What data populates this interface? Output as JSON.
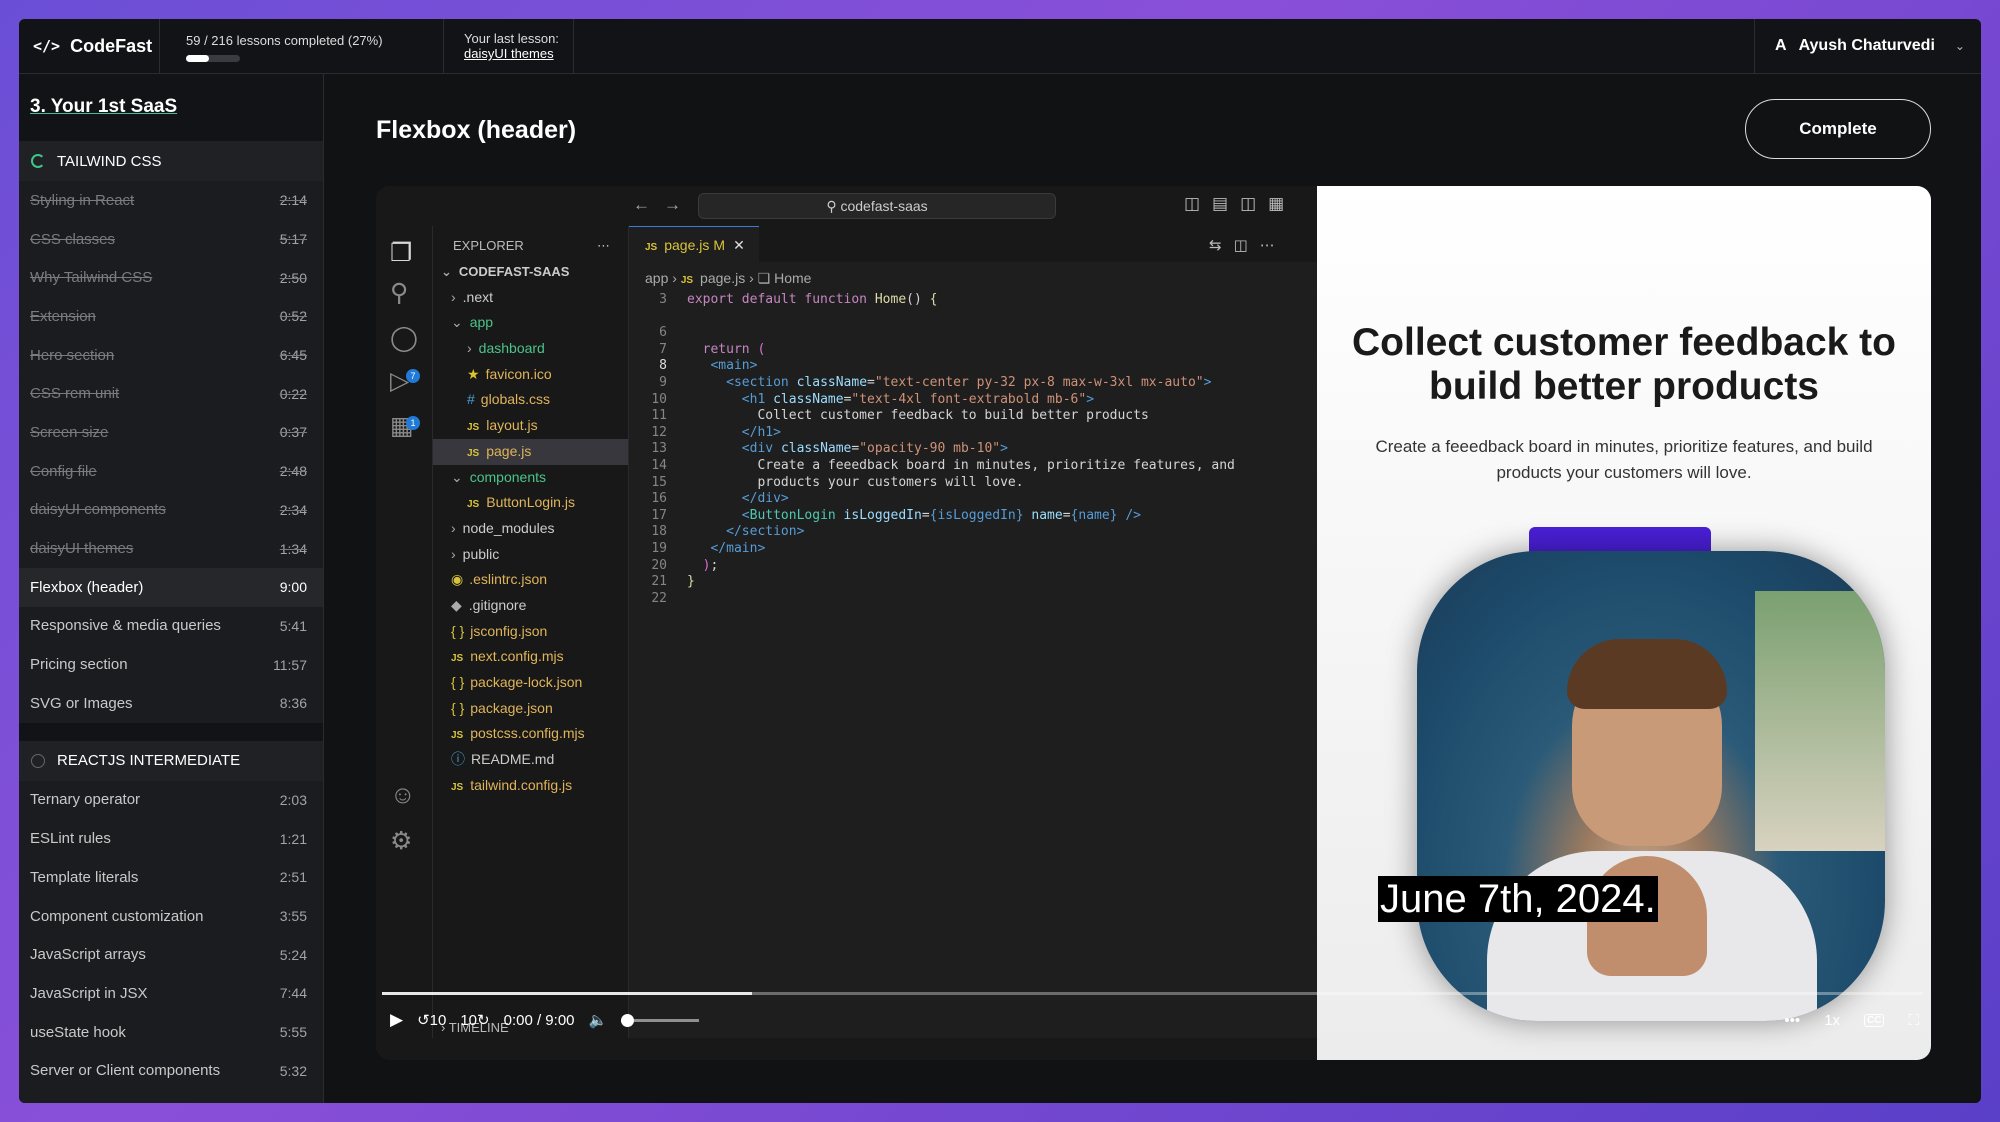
{
  "app": {
    "brand": "CodeFast",
    "progress_text": "59 / 216 lessons completed (27%)",
    "progress_fraction": 0.27,
    "last_lesson_label": "Your last lesson:",
    "last_lesson_link": "daisyUI themes",
    "user_initial": "A",
    "user_name": "Ayush Chaturvedi"
  },
  "sidebar": {
    "course_title": "3. Your 1st SaaS",
    "sections": [
      {
        "title": "TAILWIND CSS",
        "lessons": [
          {
            "label": "Styling in React",
            "duration": "2:14",
            "done": true
          },
          {
            "label": "CSS classes",
            "duration": "5:17",
            "done": true
          },
          {
            "label": "Why Tailwind CSS",
            "duration": "2:50",
            "done": true
          },
          {
            "label": "Extension",
            "duration": "0:52",
            "done": true
          },
          {
            "label": "Hero section",
            "duration": "6:45",
            "done": true
          },
          {
            "label": "CSS rem unit",
            "duration": "0:22",
            "done": true
          },
          {
            "label": "Screen size",
            "duration": "0:37",
            "done": true
          },
          {
            "label": "Config file",
            "duration": "2:48",
            "done": true
          },
          {
            "label": "daisyUI components",
            "duration": "2:34",
            "done": true
          },
          {
            "label": "daisyUI themes",
            "duration": "1:34",
            "done": true
          },
          {
            "label": "Flexbox (header)",
            "duration": "9:00",
            "active": true
          },
          {
            "label": "Responsive & media queries",
            "duration": "5:41"
          },
          {
            "label": "Pricing section",
            "duration": "11:57"
          },
          {
            "label": "SVG or Images",
            "duration": "8:36"
          }
        ]
      },
      {
        "title": "REACTJS INTERMEDIATE",
        "lessons": [
          {
            "label": "Ternary operator",
            "duration": "2:03"
          },
          {
            "label": "ESLint rules",
            "duration": "1:21"
          },
          {
            "label": "Template literals",
            "duration": "2:51"
          },
          {
            "label": "Component customization",
            "duration": "3:55"
          },
          {
            "label": "JavaScript arrays",
            "duration": "5:24"
          },
          {
            "label": "JavaScript in JSX",
            "duration": "7:44"
          },
          {
            "label": "useState hook",
            "duration": "5:55"
          },
          {
            "label": "Server or Client components",
            "duration": "5:32"
          }
        ]
      }
    ]
  },
  "main": {
    "title": "Flexbox (header)",
    "complete_label": "Complete"
  },
  "editor": {
    "search": "codefast-saas",
    "explorer_label": "EXPLORER",
    "project": "CODEFAST-SAAS",
    "tab_name": "page.js",
    "tab_modified": "M",
    "breadcrumb": [
      "app",
      "page.js",
      "Home"
    ],
    "timeline": "TIMELINE",
    "tree": [
      {
        "label": ".next",
        "kind": "folder",
        "depth": 1
      },
      {
        "label": "app",
        "kind": "folder-open",
        "depth": 1
      },
      {
        "label": "dashboard",
        "kind": "folder",
        "depth": 2
      },
      {
        "label": "favicon.ico",
        "kind": "star",
        "depth": 2
      },
      {
        "label": "globals.css",
        "kind": "css",
        "depth": 2
      },
      {
        "label": "layout.js",
        "kind": "js",
        "depth": 2
      },
      {
        "label": "page.js",
        "kind": "js",
        "depth": 2,
        "selected": true
      },
      {
        "label": "components",
        "kind": "folder-open",
        "depth": 1
      },
      {
        "label": "ButtonLogin.js",
        "kind": "js",
        "depth": 2
      },
      {
        "label": "node_modules",
        "kind": "folder",
        "depth": 1
      },
      {
        "label": "public",
        "kind": "folder",
        "depth": 1
      },
      {
        "label": ".eslintrc.json",
        "kind": "eslint",
        "depth": 1
      },
      {
        "label": ".gitignore",
        "kind": "git",
        "depth": 1
      },
      {
        "label": "jsconfig.json",
        "kind": "json",
        "depth": 1
      },
      {
        "label": "next.config.mjs",
        "kind": "js",
        "depth": 1
      },
      {
        "label": "package-lock.json",
        "kind": "json",
        "depth": 1
      },
      {
        "label": "package.json",
        "kind": "json",
        "depth": 1
      },
      {
        "label": "postcss.config.mjs",
        "kind": "js",
        "depth": 1
      },
      {
        "label": "README.md",
        "kind": "info",
        "depth": 1
      },
      {
        "label": "tailwind.config.js",
        "kind": "js",
        "depth": 1
      }
    ],
    "code_lines": [
      {
        "n": "3",
        "html": "<span class=\"kw\">export default function</span> <span class=\"fn\">Home</span>() <span class=\"fn\">{</span>"
      },
      {
        "n": "",
        "html": ""
      },
      {
        "n": "6",
        "html": ""
      },
      {
        "n": "7",
        "html": "  <span class=\"kw\">return</span> <span class=\"brace\">(</span>"
      },
      {
        "n": "8",
        "html": "   <span class=\"tagc\">&lt;main&gt;</span>",
        "cur": true
      },
      {
        "n": "9",
        "html": "     <span class=\"tagc\">&lt;section</span> <span class=\"att\">className</span>=<span class=\"str\">\"text-center py-32 px-8 max-w-3xl mx-auto\"</span><span class=\"tagc\">&gt;</span>"
      },
      {
        "n": "10",
        "html": "       <span class=\"tagc\">&lt;h1</span> <span class=\"att\">className</span>=<span class=\"str\">\"text-4xl font-extrabold mb-6\"</span><span class=\"tagc\">&gt;</span>"
      },
      {
        "n": "11",
        "html": "         Collect customer feedback to build better products"
      },
      {
        "n": "12",
        "html": "       <span class=\"tagc\">&lt;/h1&gt;</span>"
      },
      {
        "n": "13",
        "html": "       <span class=\"tagc\">&lt;div</span> <span class=\"att\">className</span>=<span class=\"str\">\"opacity-90 mb-10\"</span><span class=\"tagc\">&gt;</span>"
      },
      {
        "n": "14",
        "html": "         Create a feeedback board in minutes, prioritize features, and"
      },
      {
        "n": "15",
        "html": "         products your customers will love."
      },
      {
        "n": "16",
        "html": "       <span class=\"tagc\">&lt;/div&gt;</span>"
      },
      {
        "n": "17",
        "html": "       <span class=\"tagc\">&lt;</span><span class=\"cmp\">ButtonLogin</span> <span class=\"att\">isLoggedIn</span>=<span class=\"kb\">{isLoggedIn}</span> <span class=\"att\">name</span>=<span class=\"kb\">{name}</span> <span class=\"tagc\">/&gt;</span>"
      },
      {
        "n": "18",
        "html": "     <span class=\"tagc\">&lt;/section&gt;</span>"
      },
      {
        "n": "19",
        "html": "   <span class=\"tagc\">&lt;/main&gt;</span>"
      },
      {
        "n": "20",
        "html": "  <span class=\"brace\">)</span>;"
      },
      {
        "n": "21",
        "html": "<span class=\"fn\">}</span>"
      },
      {
        "n": "22",
        "html": ""
      }
    ]
  },
  "preview": {
    "heading": "Collect customer feedback to build better products",
    "paragraph": "Create a feeedback board in minutes, prioritize features, and build products your customers will love."
  },
  "video": {
    "caption": "June 7th, 2024.",
    "rewind_label": "10",
    "forward_label": "10",
    "time": "0:00 / 9:00",
    "speed": "1x",
    "cc_label": "CC",
    "played_fraction": 0.0,
    "buffered_fraction": 0.24,
    "volume_fraction": 0.0
  }
}
